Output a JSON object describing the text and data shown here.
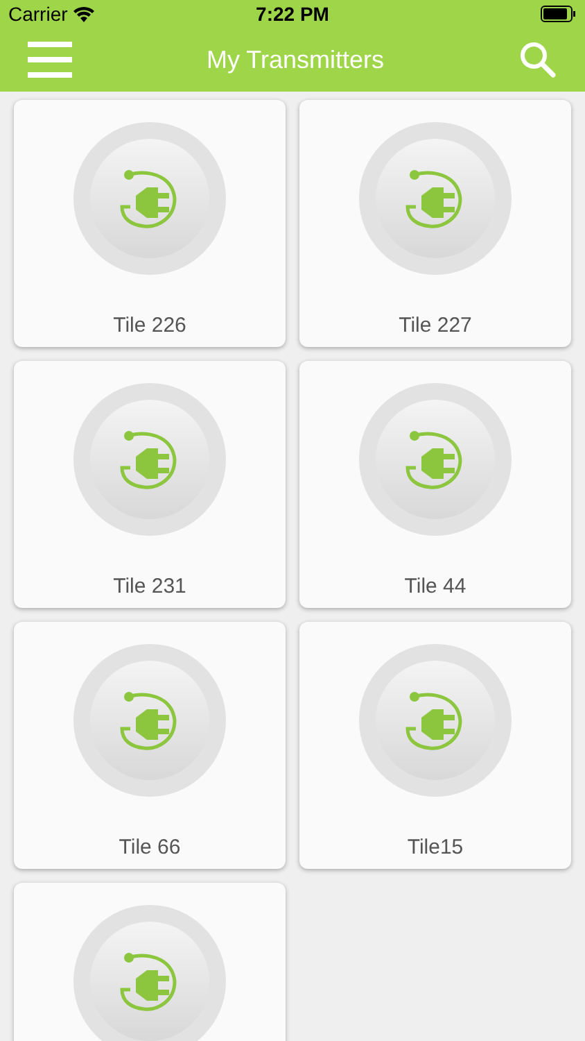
{
  "status_bar": {
    "carrier": "Carrier",
    "time": "7:22 PM"
  },
  "nav": {
    "title": "My Transmitters"
  },
  "tiles": [
    {
      "kind": "plug",
      "title": "Tile 226"
    },
    {
      "kind": "plug",
      "title": "Tile 227"
    },
    {
      "kind": "plug",
      "title": "Tile 231"
    },
    {
      "kind": "plug",
      "title": "Tile 44"
    },
    {
      "kind": "plug",
      "title": "Tile 66"
    },
    {
      "kind": "plug",
      "title": "Tile15"
    },
    {
      "kind": "plug"
    }
  ]
}
